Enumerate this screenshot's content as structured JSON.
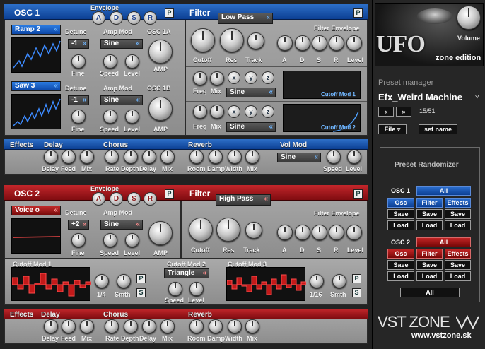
{
  "osc1": {
    "title": "OSC 1",
    "envelope_label": "Envelope",
    "adsr": [
      "A",
      "D",
      "S",
      "R"
    ],
    "p_label": "P",
    "osc1a": {
      "wave": "Ramp 2",
      "detune_label": "Detune",
      "detune_value": "-1",
      "fine_label": "Fine",
      "ampmod_label": "Amp Mod",
      "ampmod_value": "Sine",
      "speed_label": "Speed",
      "level_label": "Level",
      "title": "OSC 1A",
      "amp_label": "AMP"
    },
    "osc1b": {
      "wave": "Saw 3",
      "detune_label": "Detune",
      "detune_value": "-1",
      "fine_label": "Fine",
      "ampmod_label": "Amp Mod",
      "ampmod_value": "Sine",
      "speed_label": "Speed",
      "level_label": "Level",
      "title": "OSC 1B",
      "amp_label": "AMP"
    }
  },
  "filter1": {
    "title": "Filter",
    "type": "Low Pass",
    "cutoff_label": "Cutoff",
    "res_label": "Res",
    "track_label": "Track",
    "env_title": "Filter Envelope",
    "env_labels": [
      "A",
      "D",
      "S",
      "R",
      "Level"
    ],
    "mod_labels": [
      "Freq",
      "Mix"
    ],
    "xyz": [
      "x",
      "y",
      "z"
    ],
    "mod1": {
      "shape": "Sine",
      "name": "Cutoff Mod 1"
    },
    "mod2": {
      "shape": "Sine",
      "name": "Cutoff Mod 2"
    }
  },
  "effects1": {
    "title": "Effects",
    "delay_label": "Delay",
    "delay_knobs": [
      "Delay",
      "Feed",
      "Mix"
    ],
    "chorus_label": "Chorus",
    "chorus_knobs": [
      "Rate",
      "Depth",
      "Delay",
      "Mix"
    ],
    "reverb_label": "Reverb",
    "reverb_knobs": [
      "Room",
      "Damp",
      "Width",
      "Mix"
    ],
    "volmod_label": "Vol Mod",
    "volmod_value": "Sine",
    "volmod_knobs": [
      "Speed",
      "Level"
    ]
  },
  "osc2": {
    "title": "OSC 2",
    "envelope_label": "Envelope",
    "adsr": [
      "A",
      "D",
      "S",
      "R"
    ],
    "p_label": "P",
    "wave": "Voice o",
    "detune_label": "Detune",
    "detune_value": "+2",
    "fine_label": "Fine",
    "ampmod_label": "Amp Mod",
    "ampmod_value": "Sine",
    "speed_label": "Speed",
    "level_label": "Level",
    "amp_label": "AMP"
  },
  "filter2": {
    "title": "Filter",
    "type": "High Pass",
    "cutoff_label": "Cutoff",
    "res_label": "Res",
    "track_label": "Track",
    "env_title": "Filter Envelope",
    "env_labels": [
      "A",
      "D",
      "S",
      "R",
      "Level"
    ]
  },
  "cutoffmods": {
    "mod1": {
      "title": "Cutoff Mod 1",
      "rate": "1/4",
      "smth_label": "Smth"
    },
    "mod2": {
      "title": "Cutoff Mod 2",
      "shape": "Triangle",
      "speed_label": "Speed",
      "level_label": "Level"
    },
    "mod3": {
      "title": "Cutoff Mod 3",
      "rate": "1/16",
      "smth_label": "Smth"
    },
    "p_label": "P",
    "s_label": "S"
  },
  "effects2": {
    "title": "Effects",
    "delay_label": "Delay",
    "delay_knobs": [
      "Delay",
      "Feed",
      "Mix"
    ],
    "chorus_label": "Chorus",
    "chorus_knobs": [
      "Rate",
      "Depth",
      "Delay",
      "Mix"
    ],
    "reverb_label": "Reverb",
    "reverb_knobs": [
      "Room",
      "Damp",
      "Width",
      "Mix"
    ]
  },
  "sidebar": {
    "logo_text": "UFO",
    "edition": "zone edition",
    "volume_label": "Volume",
    "preset_manager_label": "Preset manager",
    "preset_name": "Efx_Weird Machine",
    "prev": "«",
    "next": "»",
    "counter": "15/51",
    "file_label": "File ▿",
    "set_name_label": "set name",
    "randomizer_title": "Preset Randomizer",
    "osc1_label": "OSC 1",
    "osc2_label": "OSC 2",
    "all_label": "All",
    "osc_label": "Osc",
    "filter_label": "Filter",
    "effects_label": "Effects",
    "save_label": "Save",
    "load_label": "Load",
    "brand": "VST ZONE",
    "url": "www.vstzone.sk"
  },
  "colors": {
    "blue": "#0c47a8",
    "red": "#9a1116",
    "panel": "#9a9a9a"
  }
}
